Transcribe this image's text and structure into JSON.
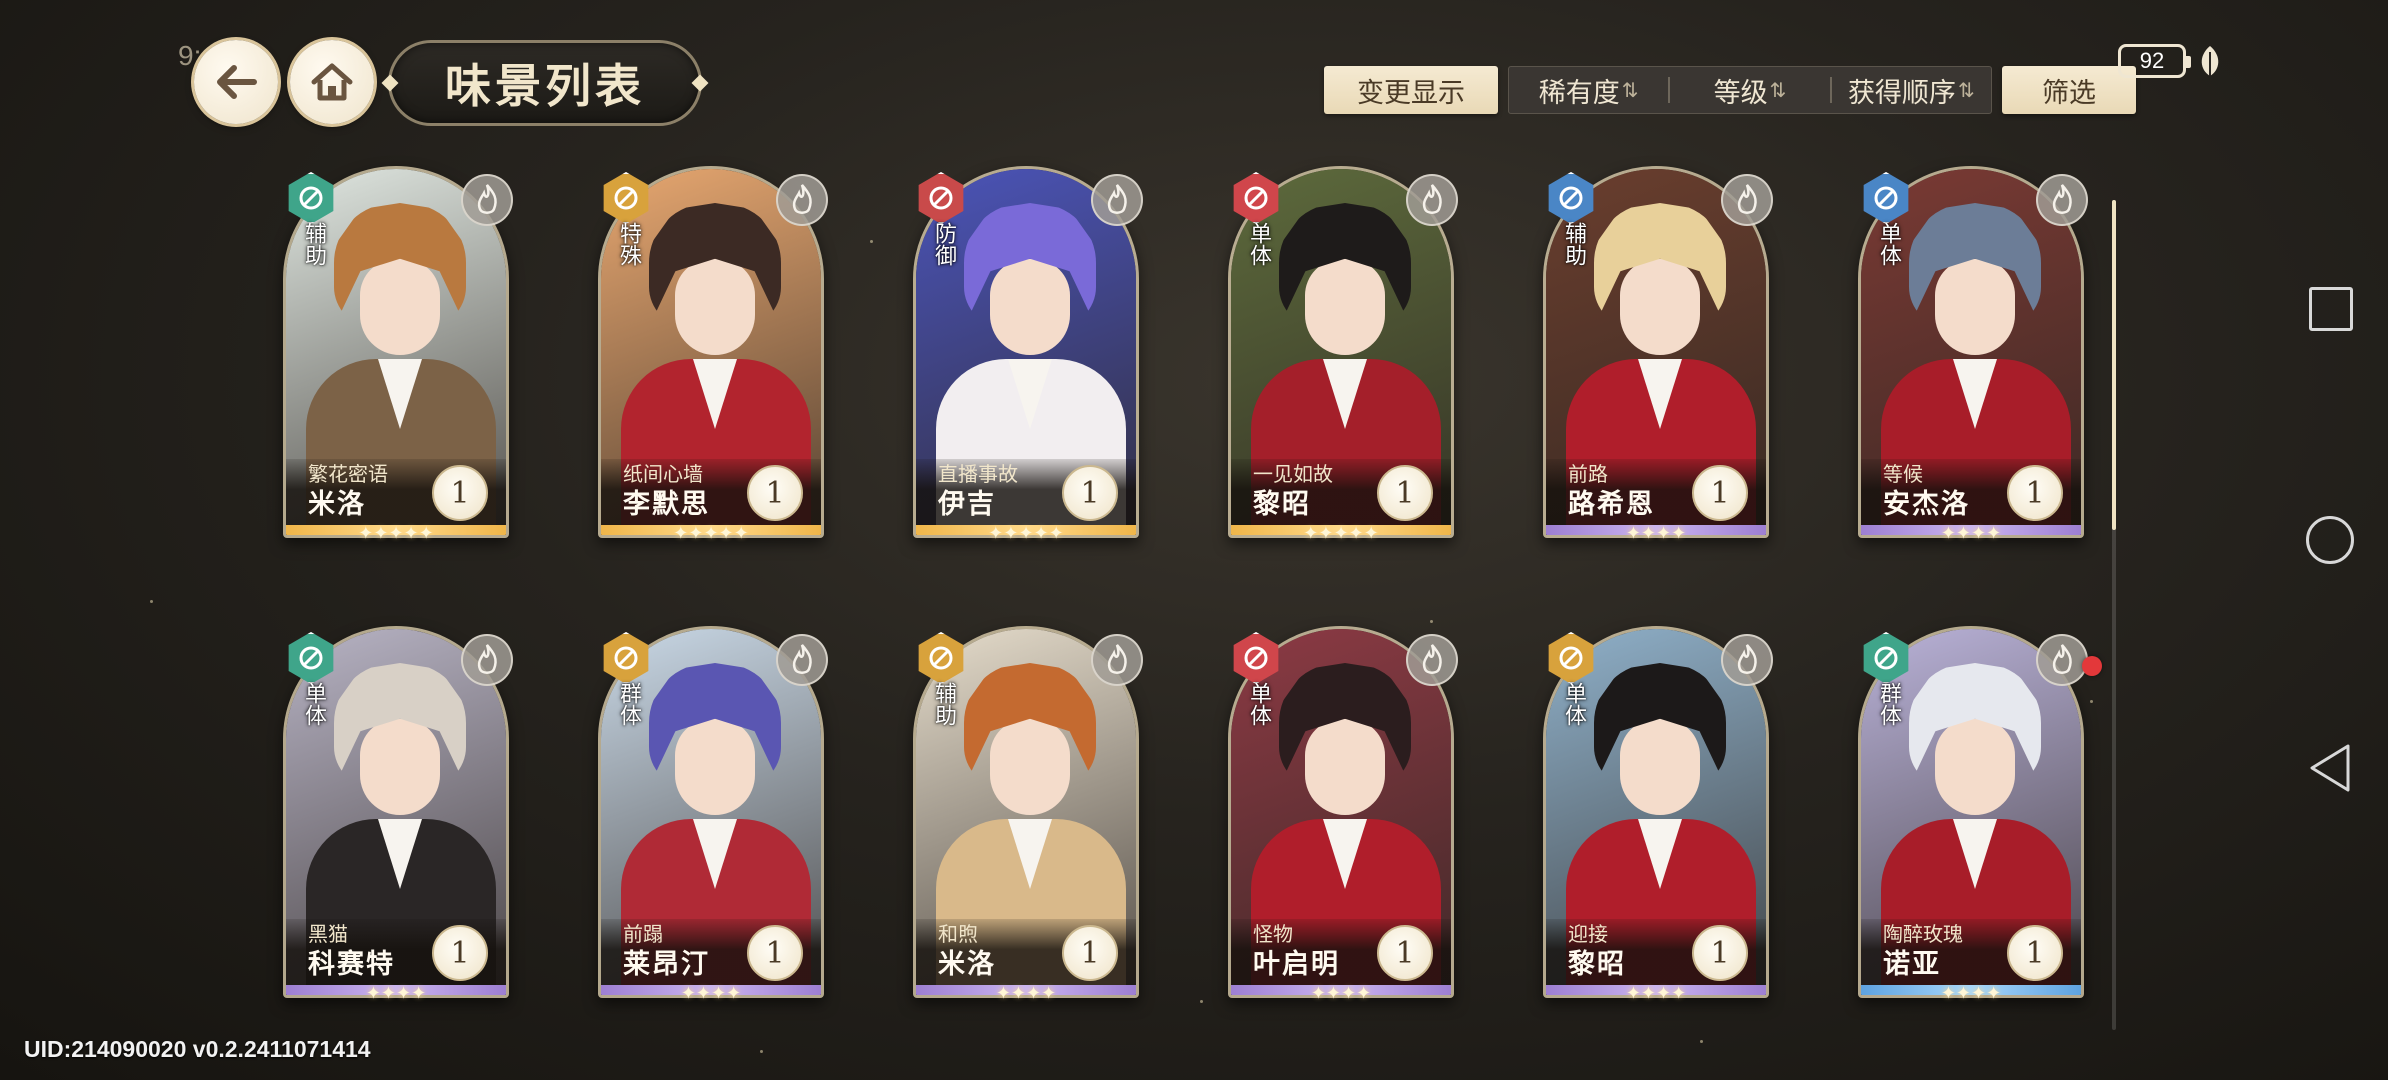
{
  "status_bar": {
    "time_partial": "9:",
    "battery": "92"
  },
  "header": {
    "title": "味景列表",
    "back_icon": "arrow-left-icon",
    "home_icon": "home-icon"
  },
  "toolbar": {
    "change_display": "变更显示",
    "sort_options": [
      {
        "label": "稀有度",
        "arrows": "⇅"
      },
      {
        "label": "等级",
        "arrows": "⇅"
      },
      {
        "label": "获得顺序",
        "arrows": "⇅"
      }
    ],
    "filter": "筛选"
  },
  "colors": {
    "support_green": "#3fa58a",
    "special_gold": "#d8a23c",
    "defense_red": "#c94a4a",
    "single_red": "#d0464b",
    "single_blue": "#4a86c6",
    "group_gold": "#d8a23c",
    "gold_rarity": "#e7a23a",
    "purple_rarity": "#a98ad6",
    "blue_rarity": "#6fb1e6"
  },
  "cards": [
    {
      "role": "辅助",
      "role_color": "#3fa58a",
      "subtitle": "繁花密语",
      "name": "米洛",
      "level": "1",
      "rarity": "gold",
      "stars": 5,
      "palette": {
        "bg": "#dfe6e0",
        "hair": "#b9793f",
        "body": "#7c6247"
      }
    },
    {
      "role": "特殊",
      "role_color": "#d8a23c",
      "subtitle": "纸间心墙",
      "name": "李默思",
      "level": "1",
      "rarity": "gold",
      "stars": 5,
      "palette": {
        "bg": "#e7a770",
        "hair": "#3c2a24",
        "body": "#b2242e"
      }
    },
    {
      "role": "防御",
      "role_color": "#c94a4a",
      "subtitle": "直播事故",
      "name": "伊吉",
      "level": "1",
      "rarity": "gold",
      "stars": 5,
      "palette": {
        "bg": "#4b54b8",
        "hair": "#7a6ad8",
        "body": "#f2eef0"
      }
    },
    {
      "role": "单体",
      "role_color": "#d0464b",
      "subtitle": "一见如故",
      "name": "黎昭",
      "level": "1",
      "rarity": "gold",
      "stars": 5,
      "palette": {
        "bg": "#5d6a3c",
        "hair": "#1e1b1a",
        "body": "#a41f2a"
      }
    },
    {
      "role": "辅助",
      "role_color": "#4a86c6",
      "subtitle": "前路",
      "name": "路希恩",
      "level": "1",
      "rarity": "purple",
      "stars": 4,
      "palette": {
        "bg": "#6a3e2e",
        "hair": "#e8d09a",
        "body": "#b01e2b"
      }
    },
    {
      "role": "单体",
      "role_color": "#4a86c6",
      "subtitle": "等候",
      "name": "安杰洛",
      "level": "1",
      "rarity": "purple",
      "stars": 4,
      "palette": {
        "bg": "#7a3a34",
        "hair": "#6c7d97",
        "body": "#a81d29"
      }
    },
    {
      "role": "单体",
      "role_color": "#3fa58a",
      "subtitle": "黑猫",
      "name": "科赛特",
      "level": "1",
      "rarity": "purple",
      "stars": 4,
      "palette": {
        "bg": "#b7b3c4",
        "hair": "#d8d0c6",
        "body": "#2a2626"
      }
    },
    {
      "role": "群体",
      "role_color": "#d8a23c",
      "subtitle": "前蹋",
      "name": "莱昂汀",
      "level": "1",
      "rarity": "purple",
      "stars": 4,
      "palette": {
        "bg": "#c9d8e6",
        "hair": "#5a56b2",
        "body": "#b02a36"
      }
    },
    {
      "role": "辅助",
      "role_color": "#d8a23c",
      "subtitle": "和煦",
      "name": "米洛",
      "level": "1",
      "rarity": "purple",
      "stars": 4,
      "palette": {
        "bg": "#e5dccb",
        "hair": "#c46a30",
        "body": "#d9b98a"
      }
    },
    {
      "role": "单体",
      "role_color": "#d0464b",
      "subtitle": "怪物",
      "name": "叶启明",
      "level": "1",
      "rarity": "purple",
      "stars": 4,
      "palette": {
        "bg": "#8c3a44",
        "hair": "#2b1d1e",
        "body": "#b01e2b"
      }
    },
    {
      "role": "单体",
      "role_color": "#d8a23c",
      "subtitle": "迎接",
      "name": "黎昭",
      "level": "1",
      "rarity": "purple",
      "stars": 4,
      "palette": {
        "bg": "#8fb0c9",
        "hair": "#1c1919",
        "body": "#b01e2b"
      }
    },
    {
      "role": "群体",
      "role_color": "#3fa58a",
      "subtitle": "陶醉玫瑰",
      "name": "诺亚",
      "level": "1",
      "rarity": "blue",
      "stars": 4,
      "palette": {
        "bg": "#b9b2d8",
        "hair": "#e6e8ee",
        "body": "#a81d29"
      },
      "has_notification": true
    }
  ],
  "footer": {
    "uid": "UID:214090020  v0.2.2411071414"
  }
}
